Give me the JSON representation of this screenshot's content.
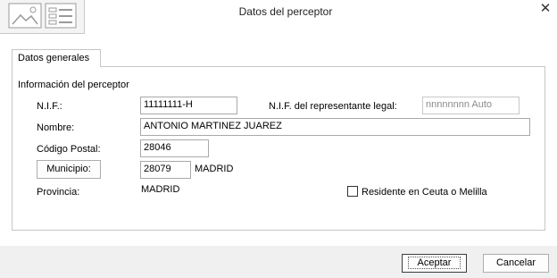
{
  "window": {
    "title": "Datos del perceptor",
    "close_symbol": "✕"
  },
  "tabs": [
    {
      "label": "Datos generales"
    }
  ],
  "section": {
    "title": "Información del perceptor"
  },
  "form": {
    "nif_label": "N.I.F.:",
    "nif_value": "11111111-H",
    "rep_label": "N.I.F. del representante legal:",
    "rep_value": "nnnnnnnn Auto",
    "nombre_label": "Nombre:",
    "nombre_value": "ANTONIO MARTINEZ JUAREZ",
    "cp_label": "Código Postal:",
    "cp_value": "28046",
    "municipio_button": "Municipio:",
    "municipio_code": "28079",
    "municipio_name": "MADRID",
    "provincia_label": "Provincia:",
    "provincia_value": "MADRID",
    "residente_label": "Residente en Ceuta o Melilla",
    "residente_checked": false
  },
  "footer": {
    "accept_label": "Aceptar",
    "cancel_label": "Cancelar"
  }
}
